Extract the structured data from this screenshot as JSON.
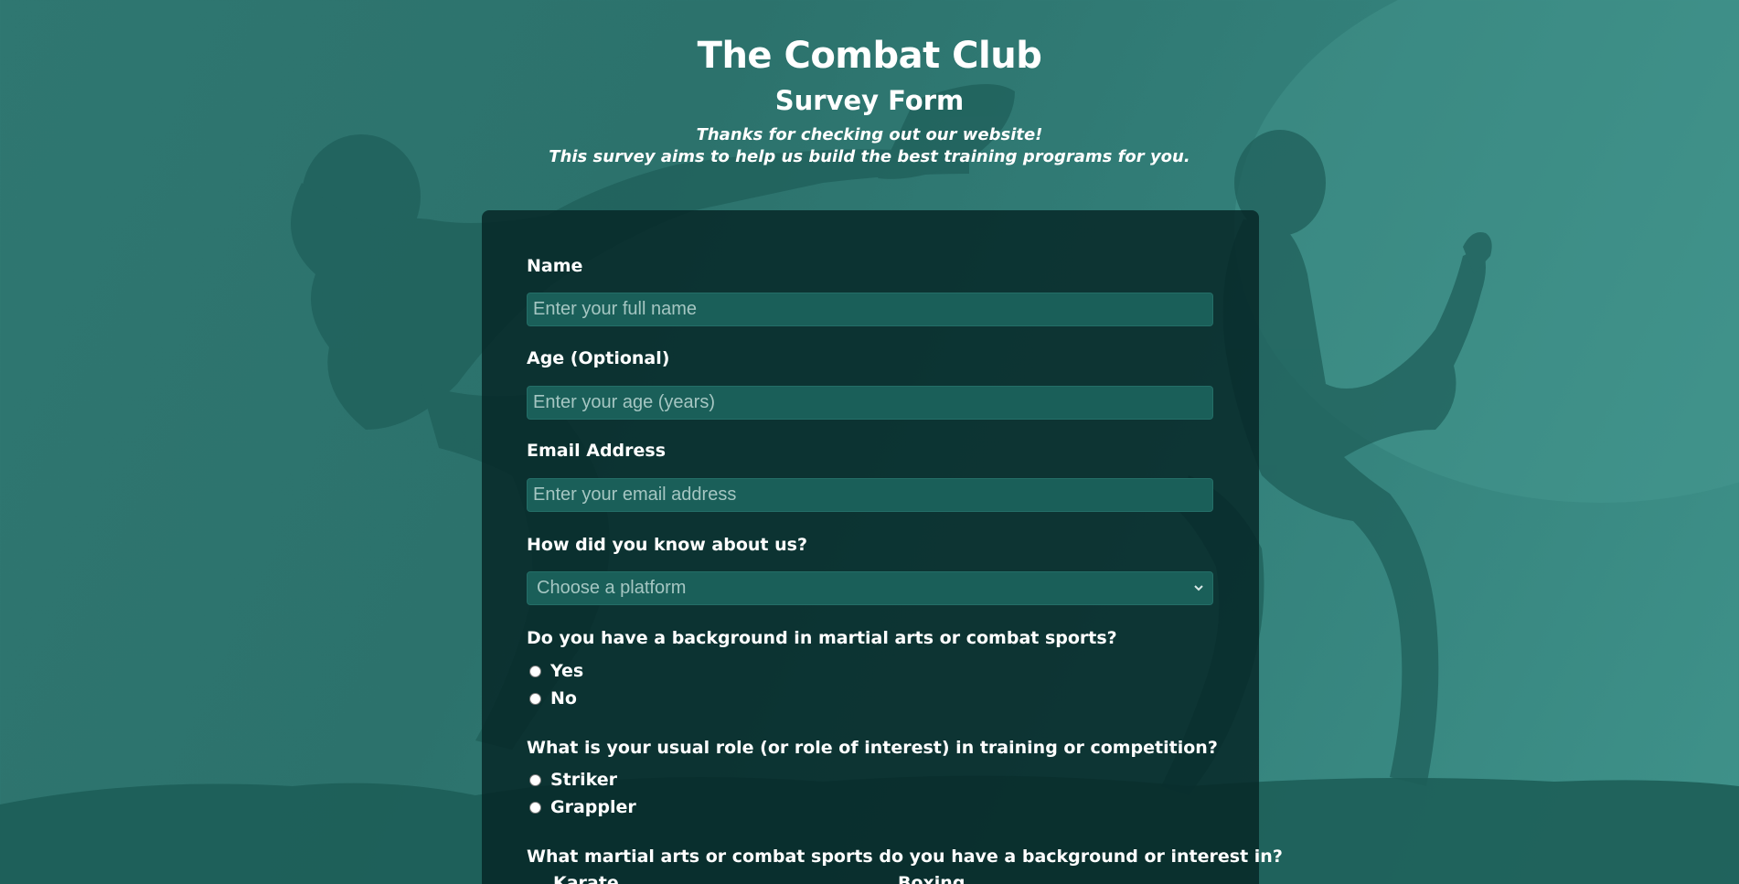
{
  "header": {
    "title": "The Combat Club",
    "subtitle": "Survey Form",
    "description_line1": "Thanks for checking out our website!",
    "description_line2": "This survey aims to help us build the best training programs for you."
  },
  "form": {
    "name": {
      "label": "Name",
      "placeholder": "Enter your full name",
      "value": ""
    },
    "age": {
      "label": "Age (Optional)",
      "placeholder": "Enter your age (years)",
      "value": ""
    },
    "email": {
      "label": "Email Address",
      "placeholder": "Enter your email address",
      "value": ""
    },
    "referral": {
      "label": "How did you know about us?",
      "selected": "Choose a platform"
    },
    "background": {
      "label": "Do you have a background in martial arts or combat sports?",
      "options": [
        "Yes",
        "No"
      ]
    },
    "role": {
      "label": "What is your usual role (or role of interest) in training or competition?",
      "options": [
        "Striker",
        "Grappler"
      ]
    },
    "arts": {
      "label": "What martial arts or combat sports do you have a background or interest in?",
      "visible_options": [
        "Karate",
        "Boxing"
      ]
    }
  },
  "colors": {
    "background": "#2f7771",
    "card": "#0a2c2c",
    "input": "#1a5f59",
    "text": "#ffffff",
    "placeholder": "#a5c6c2"
  }
}
